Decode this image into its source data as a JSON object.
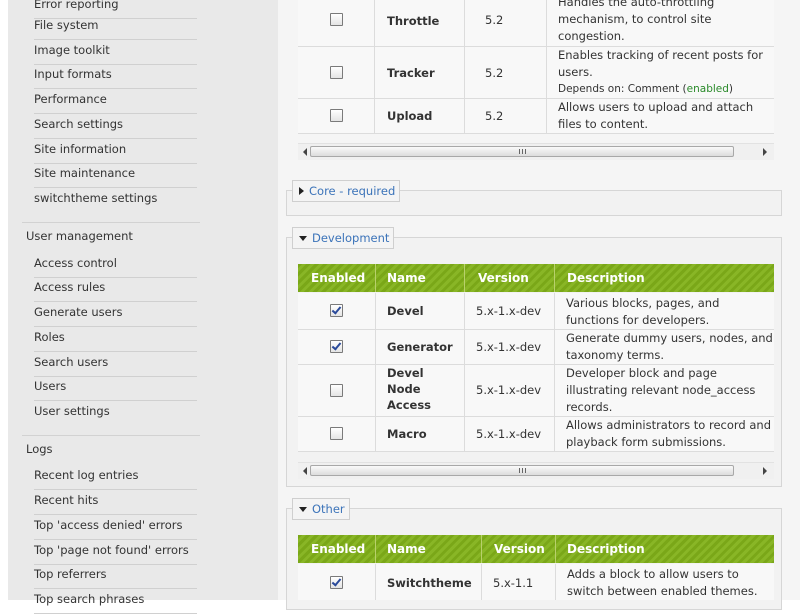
{
  "sidebar": {
    "site_config_items": [
      "Error reporting",
      "File system",
      "Image toolkit",
      "Input formats",
      "Performance",
      "Search settings",
      "Site information",
      "Site maintenance",
      "switchtheme settings"
    ],
    "user_mgmt_title": "User management",
    "user_mgmt_items": [
      "Access control",
      "Access rules",
      "Generate users",
      "Roles",
      "Search users",
      "Users",
      "User settings"
    ],
    "logs_title": "Logs",
    "logs_items": [
      "Recent log entries",
      "Recent hits",
      "Top 'access denied' errors",
      "Top 'page not found' errors",
      "Top referrers",
      "Top search phrases"
    ]
  },
  "upper_table": {
    "rows": [
      {
        "name": "Throttle",
        "version": "5.2",
        "checked": false,
        "desc": [
          "Handles the auto-throttling",
          "mechanism, to control site",
          "congestion."
        ]
      },
      {
        "name": "Tracker",
        "version": "5.2",
        "checked": false,
        "desc": [
          "Enables tracking of recent posts for",
          "users."
        ],
        "depends_prefix": "Depends on: Comment (",
        "depends_status": "enabled",
        "depends_suffix": ")"
      },
      {
        "name": "Upload",
        "version": "5.2",
        "checked": false,
        "desc": [
          "Allows users to upload and attach",
          "files to content."
        ]
      }
    ]
  },
  "fieldsets": {
    "core": {
      "label": "Core - required",
      "collapsed": true
    },
    "development": {
      "label": "Development",
      "collapsed": false
    },
    "other": {
      "label": "Other",
      "collapsed": false
    }
  },
  "headers": {
    "enabled": "Enabled",
    "name": "Name",
    "version": "Version",
    "description": "Description"
  },
  "development_table": {
    "rows": [
      {
        "name": [
          "Devel"
        ],
        "version": "5.x-1.x-dev",
        "checked": true,
        "desc": [
          "Various blocks, pages, and",
          "functions for developers."
        ]
      },
      {
        "name": [
          "Generator"
        ],
        "version": "5.x-1.x-dev",
        "checked": true,
        "desc": [
          "Generate dummy users, nodes, and",
          "taxonomy terms."
        ]
      },
      {
        "name": [
          "Devel",
          "Node",
          "Access"
        ],
        "version": "5.x-1.x-dev",
        "checked": false,
        "desc": [
          "Developer block and page",
          "illustrating relevant node_access",
          "records."
        ]
      },
      {
        "name": [
          "Macro"
        ],
        "version": "5.x-1.x-dev",
        "checked": false,
        "desc": [
          "Allows administrators to record and",
          "playback form submissions."
        ]
      }
    ]
  },
  "other_table": {
    "rows": [
      {
        "name": [
          "Switchtheme"
        ],
        "version": "5.x-1.1",
        "checked": true,
        "desc": [
          "Adds a block to allow users to",
          "switch between enabled themes."
        ]
      }
    ]
  },
  "colors": {
    "header_green": "#7aa718",
    "link_blue": "#3b73b9",
    "enabled_green": "#2a8a2a"
  }
}
